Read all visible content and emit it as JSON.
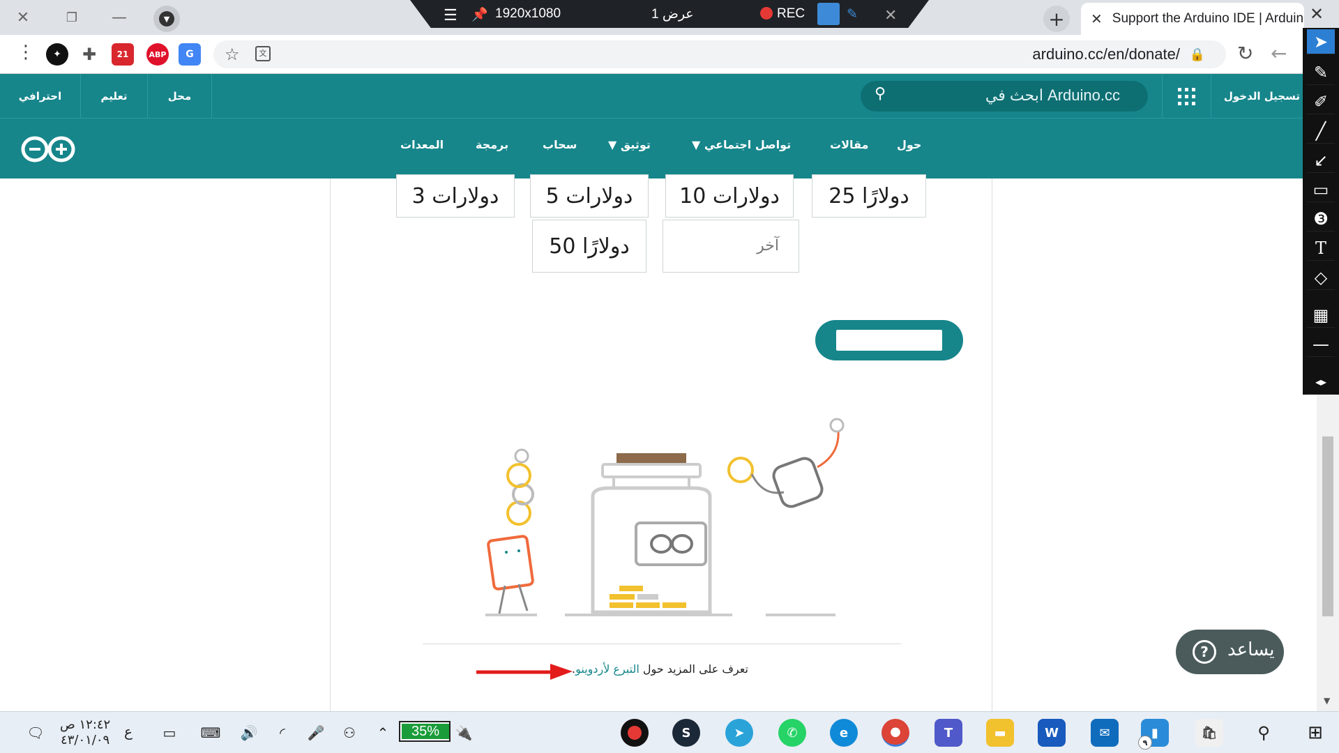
{
  "browser": {
    "active_tab_title": "Support the Arduino IDE | Arduino",
    "url": "arduino.cc/en/donate/",
    "new_tab_label": "+",
    "close_label": "✕"
  },
  "recorder": {
    "resolution": "1920x1080",
    "display": "عرض 1",
    "rec_label": "REC"
  },
  "site": {
    "top_nav": {
      "login": "تسجيل الدخول",
      "search_placeholder": "ابحث في Arduino.cc",
      "store": "محل",
      "education": "تعليم",
      "pro": "احترافي"
    },
    "main_nav": {
      "about": "حول",
      "articles": "مقالات",
      "community": "تواصل اجتماعي",
      "documentation": "توثيق",
      "cloud": "سحاب",
      "software": "برمجة",
      "hardware": "المعدات"
    }
  },
  "donate": {
    "amounts": [
      "دولارات 3",
      "دولارات 5",
      "دولارات 10",
      "دولارًا 25",
      "دولارًا 50"
    ],
    "other_placeholder": "آخر",
    "learn_more_prefix": "تعرف على المزيد حول ",
    "learn_more_link": "التبرع لأردوينو",
    "learn_more_suffix": "."
  },
  "help": {
    "label": "يساعد",
    "icon": "?"
  },
  "taskbar": {
    "time": "١٢:٤٢ ص",
    "date": "٤٣/٠١/٠٩",
    "lang": "ع",
    "battery": "35%",
    "notification_badge": "٩"
  },
  "colors": {
    "arduino_teal": "#16868b",
    "arduino_dark": "#0e6f73",
    "help_bg": "#4b5b5c",
    "battery_green": "#1a9c3a",
    "rec_red": "#e53935",
    "annotation_arrow": "#e31b1b"
  },
  "icons": {
    "tab_close": "close-icon",
    "star": "star-icon",
    "lock": "lock-icon",
    "search": "search-icon",
    "apps": "apps-grid-icon",
    "help": "help-icon"
  }
}
